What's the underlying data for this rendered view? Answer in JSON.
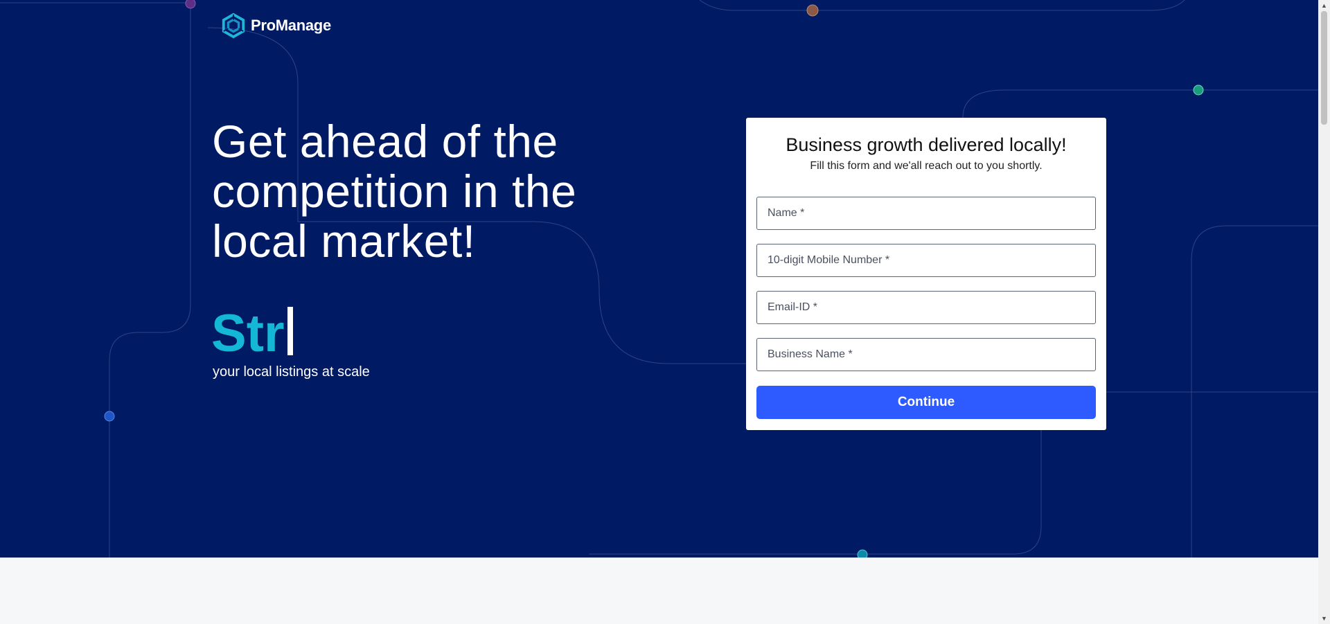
{
  "brand": {
    "name": "ProManage"
  },
  "hero": {
    "headline": "Get ahead of the competition in the local market!",
    "typed_text": "Str",
    "subline": "your local listings at scale"
  },
  "form": {
    "title": "Business growth delivered locally!",
    "subtitle": "Fill this form and we'all reach out to you shortly.",
    "fields": [
      {
        "placeholder": "Name *",
        "value": ""
      },
      {
        "placeholder": "10-digit Mobile Number *",
        "value": ""
      },
      {
        "placeholder": "Email-ID *",
        "value": ""
      },
      {
        "placeholder": "Business Name *",
        "value": ""
      }
    ],
    "submit_label": "Continue"
  },
  "colors": {
    "hero_background": "#001a63",
    "accent_text": "#14b8d6",
    "button": "#2d5bff",
    "page_background": "#f5f7f9"
  },
  "icons": {
    "logo": "promanage-hexagon-logo-icon",
    "scroll_up": "triangle-up-icon",
    "scroll_down": "triangle-down-icon"
  }
}
